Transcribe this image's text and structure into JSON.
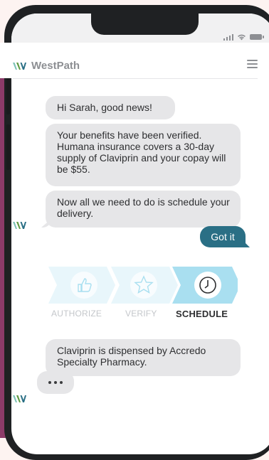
{
  "brand": {
    "name": "WestPath"
  },
  "messages": {
    "m1": "Hi Sarah, good news!",
    "m2": "Your benefits have been verified. Humana insurance covers a 30-day supply of Claviprin and your copay will be $55.",
    "m3": "Now all we need to do is schedule your delivery.",
    "m4": "Claviprin is dispensed by Accredo Specialty Pharmacy."
  },
  "reply": {
    "label": "Got it"
  },
  "steps": [
    {
      "label": "AUTHORIZE",
      "icon": "thumbs-up-icon",
      "state": "done"
    },
    {
      "label": "VERIFY",
      "icon": "star-icon",
      "state": "done"
    },
    {
      "label": "SCHEDULE",
      "icon": "clock-icon",
      "state": "active"
    }
  ],
  "typing": {
    "dots": "•••"
  },
  "colors": {
    "brand_teal": "#2a6f85",
    "bubble_gray": "#e6e6e8",
    "step_done": "#e8f6fb",
    "step_active": "#a9dff0",
    "accent_magenta": "#8c3b69"
  }
}
